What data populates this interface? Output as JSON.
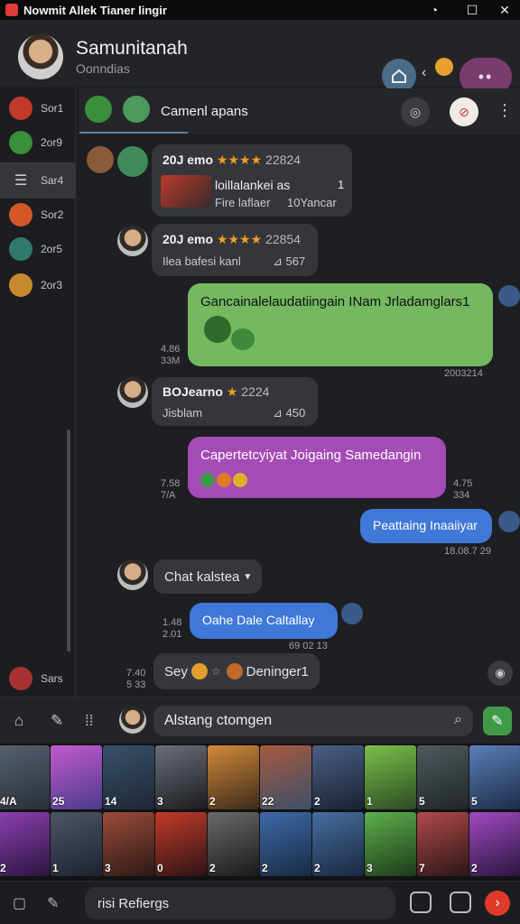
{
  "window": {
    "title": "Nowmit Allek Tianer lingir"
  },
  "header": {
    "name": "Samunitanah",
    "subtitle": "Oonndias"
  },
  "sidebar": {
    "items": [
      {
        "label": "Sor1",
        "color": "#c0392b"
      },
      {
        "label": "2or9",
        "color": "#3a8f3a"
      },
      {
        "label": "Sar4",
        "color": ""
      },
      {
        "label": "Sor2",
        "color": "#d4572a"
      },
      {
        "label": "2or5",
        "color": "#2f7a6a"
      },
      {
        "label": "2or3",
        "color": "#c58a2a"
      },
      {
        "label": "Sars",
        "color": "#a83232"
      }
    ]
  },
  "chat": {
    "title": "Camenl apans",
    "messages": [
      {
        "name": "20J emo",
        "stars": "★★★★",
        "num": "22824",
        "line1": "loillalankei as",
        "line1_num": "1",
        "line2": "Fire laflaer",
        "line2_num": "10Yancar"
      },
      {
        "name": "20J emo",
        "stars": "★★★★",
        "num": "22854",
        "line1": "Ilea bafesi kanl",
        "line1_num": "567"
      },
      {
        "bubble": "Gancainalelaudatiingain INam Jrladamglars1",
        "time_left": "4.86\n33M",
        "time_right": "2003214"
      },
      {
        "name": "BOJearno",
        "stars": "★",
        "num": "2224",
        "line1": "Jisblam",
        "line1_num": "450"
      },
      {
        "bubble": "Capertetcyiyat Joigaing Samedangin",
        "time_left": "7.58\n7/A",
        "time_right": "4.75\n334"
      },
      {
        "bubble": "Peattaing Inaaiiyar",
        "time_right": "18.08.7 29"
      },
      {
        "chip": "Chat kalstea"
      },
      {
        "bubble": "Oahe Dale Caltallay",
        "time_left": "1.48\n2.01",
        "time_right": "69 02 13"
      },
      {
        "chip": "Sey",
        "chip_right": "Deninger1",
        "time_left": "7.40\n5 33"
      }
    ]
  },
  "composer": {
    "placeholder": "Alstang ctomgen"
  },
  "tiles": [
    {
      "label": "4/A",
      "c1": "#556070",
      "c2": "#2a2f37"
    },
    {
      "label": "25",
      "c1": "#c35ad0",
      "c2": "#4a3b8a"
    },
    {
      "label": "14",
      "c1": "#39506a",
      "c2": "#1d2836"
    },
    {
      "label": "3",
      "c1": "#6a6f78",
      "c2": "#1b1c20"
    },
    {
      "label": "2",
      "c1": "#d08a3a",
      "c2": "#3e2a1a"
    },
    {
      "label": "22",
      "c1": "#a65a3e",
      "c2": "#3d4f6a"
    },
    {
      "label": "2",
      "c1": "#4a5f85",
      "c2": "#1a2233"
    },
    {
      "label": "1",
      "c1": "#7bc04a",
      "c2": "#2c4a22"
    },
    {
      "label": "5",
      "c1": "#4f5a5e",
      "c2": "#202528"
    },
    {
      "label": "5",
      "c1": "#5a7fb8",
      "c2": "#1d2c48"
    },
    {
      "label": "2",
      "c1": "#8c3fb0",
      "c2": "#2a1640"
    },
    {
      "label": "1",
      "c1": "#4c5568",
      "c2": "#1e2330"
    },
    {
      "label": "3",
      "c1": "#9c4a3a",
      "c2": "#2c1a16"
    },
    {
      "label": "0",
      "c1": "#c23a2a",
      "c2": "#2c1414"
    },
    {
      "label": "2",
      "c1": "#6a6a6a",
      "c2": "#1a1a1a"
    },
    {
      "label": "2",
      "c1": "#3f6aa8",
      "c2": "#182a44"
    },
    {
      "label": "2",
      "c1": "#466e9e",
      "c2": "#1a2840"
    },
    {
      "label": "3",
      "c1": "#5db04c",
      "c2": "#1e3a1a"
    },
    {
      "label": "7",
      "c1": "#b04a4a",
      "c2": "#2c1616"
    },
    {
      "label": "2",
      "c1": "#a04ac0",
      "c2": "#2a1640"
    }
  ],
  "bottombar": {
    "search_label": "risi Refiergs"
  }
}
